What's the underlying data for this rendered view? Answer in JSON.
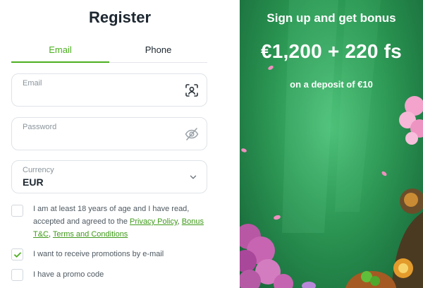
{
  "form": {
    "title": "Register",
    "tabs": [
      {
        "label": "Email",
        "active": true
      },
      {
        "label": "Phone",
        "active": false
      }
    ],
    "email": {
      "label": "Email",
      "value": ""
    },
    "password": {
      "label": "Password",
      "value": ""
    },
    "currency": {
      "label": "Currency",
      "value": "EUR"
    },
    "consent": {
      "text_before": "I am at least 18 years of age and I have read, accepted and agreed to the ",
      "privacy_link": "Privacy Policy",
      "separator": ", ",
      "bonus_link": "Bonus T&C",
      "separator2": ", ",
      "terms_link": "Terms and Conditions",
      "checked": false
    },
    "promotions": {
      "label": "I want to receive promotions by e-mail",
      "checked": true
    },
    "promo_code": {
      "label": "I have a promo code",
      "checked": false
    }
  },
  "banner": {
    "title": "Sign up and get bonus",
    "amount": "€1,200 + 220 fs",
    "subtitle": "on a deposit of €10"
  },
  "colors": {
    "accent": "#4caf1f",
    "banner_green": "#2a9a53"
  },
  "icons": {
    "email_field": "face-scan-icon",
    "password_field": "eye-off-icon",
    "currency_field": "chevron-down-icon",
    "checkbox_mark": "check-icon"
  }
}
